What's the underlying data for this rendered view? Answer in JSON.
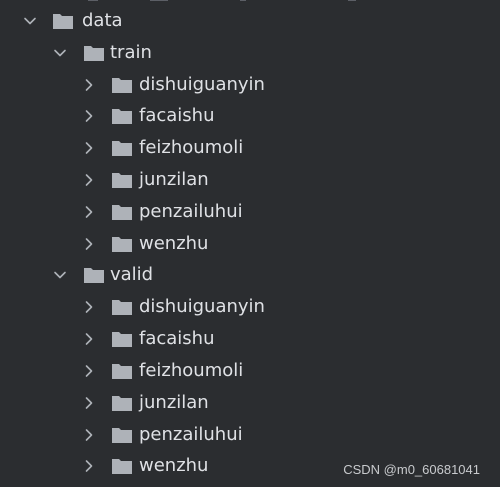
{
  "tree": {
    "root": {
      "label": "data",
      "expanded": true
    },
    "groups": [
      {
        "label": "train",
        "expanded": true,
        "children": [
          "dishuiguanyin",
          "facaishu",
          "feizhoumoli",
          "junzilan",
          "penzailuhui",
          "wenzhu"
        ]
      },
      {
        "label": "valid",
        "expanded": true,
        "children": [
          "dishuiguanyin",
          "facaishu",
          "feizhoumoli",
          "junzilan",
          "penzailuhui",
          "wenzhu"
        ]
      }
    ]
  },
  "icons": {
    "expanded": "chevron-down-icon",
    "collapsed": "chevron-right-icon",
    "folder": "folder-icon"
  },
  "colors": {
    "background": "#2b2d30",
    "text": "#dfe1e5",
    "folder": "#aeb2b8",
    "chevron": "#aeb2b8"
  },
  "watermark": "CSDN @m0_60681041"
}
